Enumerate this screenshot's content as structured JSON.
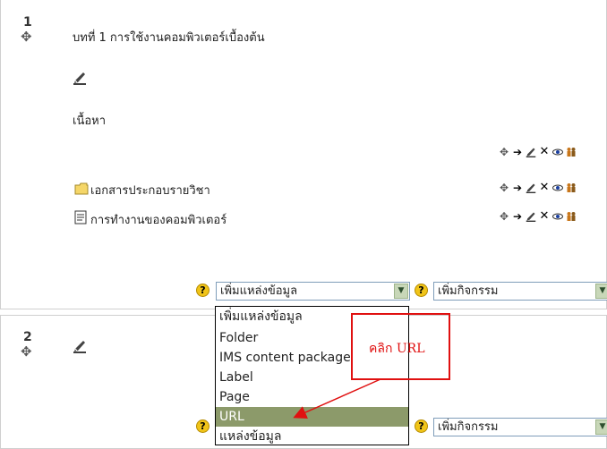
{
  "section1": {
    "number": "1",
    "title": "บทที่ 1 การใช้งานคอมพิวเตอร์เบื้องต้น",
    "subheading": "เนื้อหา",
    "resources": [
      {
        "icon": "folder-icon",
        "label": "เอกสารประกอบรายวิชา"
      },
      {
        "icon": "document-icon",
        "label": "การทำงานของคอมพิวเตอร์"
      }
    ],
    "add_resource_select": {
      "value": "เพิ่มแหล่งข้อมูล"
    },
    "add_activity_select": {
      "value": "เพิ่มกิจกรรม"
    }
  },
  "section2": {
    "number": "2",
    "add_activity_select": {
      "value": "เพิ่มกิจกรรม"
    }
  },
  "help_icon_label": "?",
  "dropdown": {
    "options": [
      "เพิ่มแหล่งข้อมูล",
      "Folder",
      "IMS content package",
      "Label",
      "Page",
      "URL",
      "แหล่งข้อมูล"
    ],
    "selected": "URL"
  },
  "callout": {
    "text": "คลิก URL",
    "color": "#e01010"
  }
}
